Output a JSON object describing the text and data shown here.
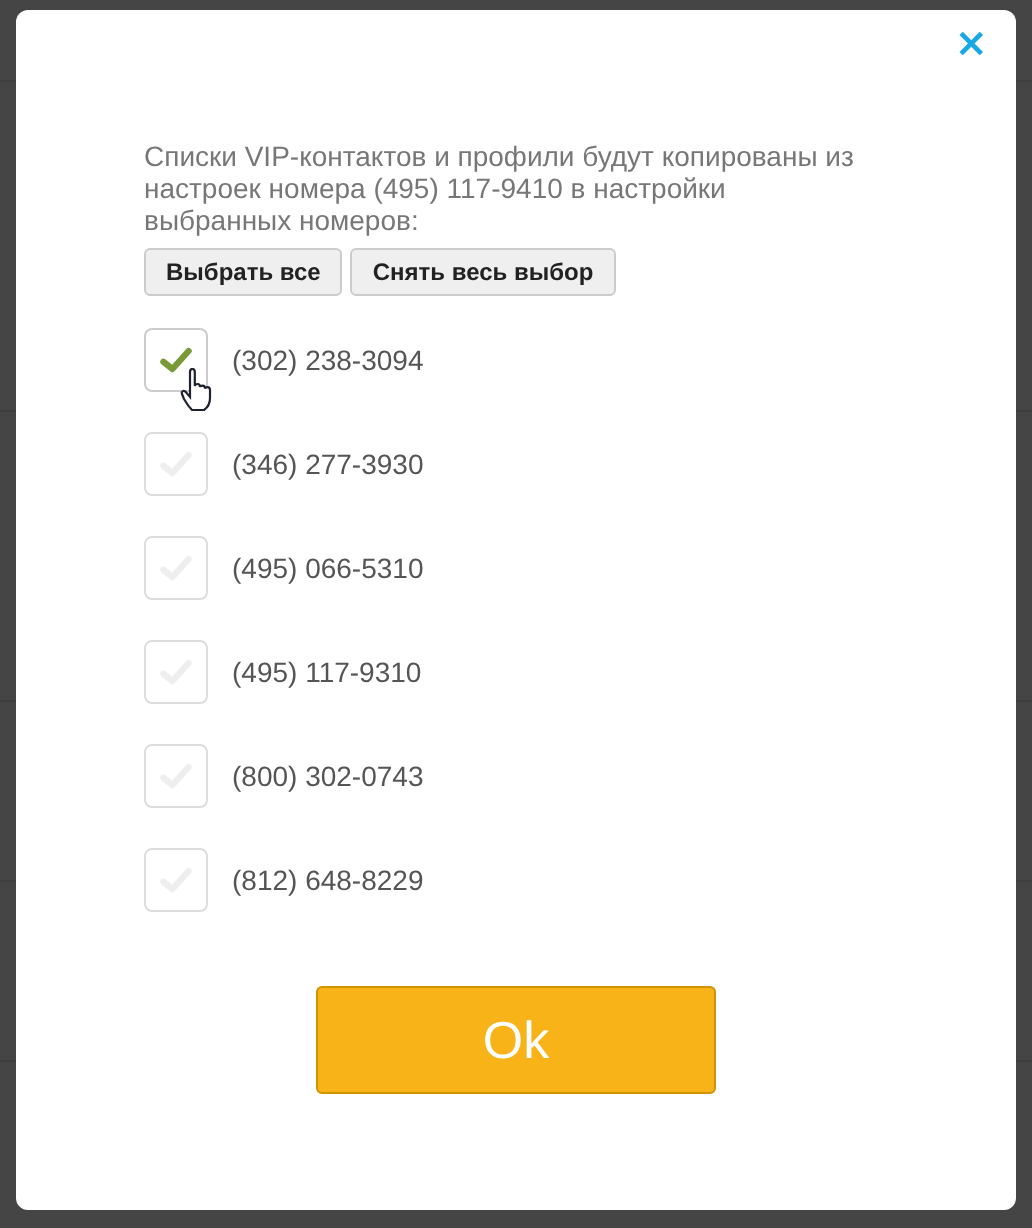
{
  "dialog": {
    "close": "×",
    "message": "Списки VIP-контактов и профили будут копированы из настроек номера (495) 117-9410 в настройки выбранных номеров:",
    "actions": [
      {
        "label": "Выбрать все"
      },
      {
        "label": "Снять весь выбор"
      }
    ],
    "numbers": [
      {
        "number": "(302) 238-3094",
        "checked": true,
        "pointer": true
      },
      {
        "number": "(346) 277-3930",
        "checked": false,
        "pointer": false
      },
      {
        "number": "(495) 066-5310",
        "checked": false,
        "pointer": false
      },
      {
        "number": "(495) 117-9310",
        "checked": false,
        "pointer": false
      },
      {
        "number": "(800) 302-0743",
        "checked": false,
        "pointer": false
      },
      {
        "number": "(812) 648-8229",
        "checked": false,
        "pointer": false
      }
    ],
    "ok": "Ok"
  }
}
